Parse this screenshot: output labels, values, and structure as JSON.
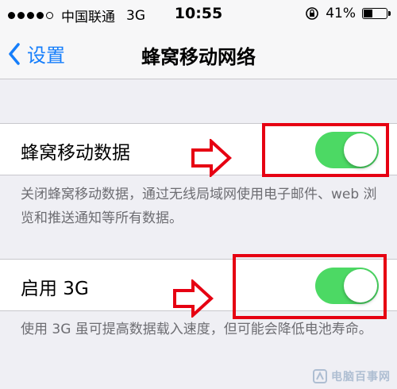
{
  "status_bar": {
    "carrier": "中国联通",
    "network": "3G",
    "time": "10:55",
    "battery": "41%",
    "battery_level": 0.41,
    "signal_bars_filled": 4,
    "signal_bars_total": 5
  },
  "nav": {
    "back_label": "设置",
    "title": "蜂窝移动网络"
  },
  "settings": {
    "cellular_data": {
      "label": "蜂窝移动数据",
      "on": true,
      "footer": "关闭蜂窝移动数据，通过无线局域网使用电子邮件、web 浏览和推送通知等所有数据。"
    },
    "enable_3g": {
      "label": "启用 3G",
      "on": true,
      "footer": "使用 3G 虽可提高数据载入速度，但可能会降低电池寿命。"
    }
  },
  "watermark": {
    "text": "电脑百事网"
  },
  "colors": {
    "accent": "#157efb",
    "toggle_on": "#4cd964",
    "highlight": "#e60012",
    "background": "#efeff4"
  },
  "icons": {
    "back": "chevron-left-icon",
    "orientation_lock": "orientation-lock-icon",
    "battery": "battery-icon",
    "annotation_arrow": "arrow-right-icon"
  }
}
